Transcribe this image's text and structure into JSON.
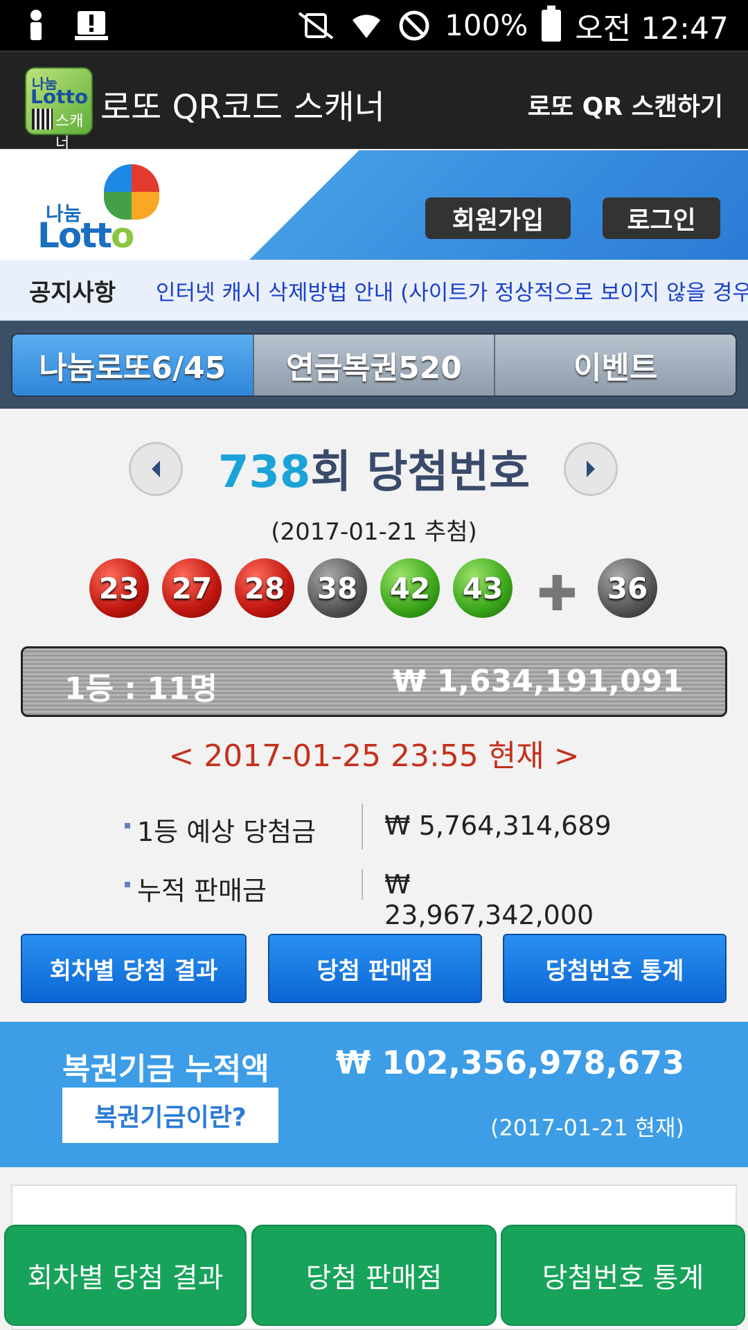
{
  "status_bar": {
    "battery": "100%",
    "time": "오전 12:47"
  },
  "action_bar": {
    "app_icon_text_1": "나눔",
    "app_icon_text_2": "Lotto",
    "app_icon_text_3": "스캐너",
    "title": "로또 QR코드 스캐너",
    "scan_button": "로또 QR 스캔하기"
  },
  "header": {
    "logo_small": "나눔",
    "logo_big_1": "Lott",
    "logo_big_2": "o",
    "join_button": "회원가입",
    "login_button": "로그인"
  },
  "notice": {
    "label": "공지사항",
    "text": "인터넷 캐시 삭제방법 안내 (사이트가 정상적으로 보이지 않을 경우"
  },
  "tabs": [
    {
      "label": "나눔로또6/45",
      "active": true
    },
    {
      "label": "연금복권520",
      "active": false
    },
    {
      "label": "이벤트",
      "active": false
    }
  ],
  "draw": {
    "round_number": "738",
    "round_suffix": "회 당첨번호",
    "date": "(2017-01-21 추첨)",
    "numbers": [
      {
        "value": "23",
        "color": "red"
      },
      {
        "value": "27",
        "color": "red"
      },
      {
        "value": "28",
        "color": "red"
      },
      {
        "value": "38",
        "color": "gray"
      },
      {
        "value": "42",
        "color": "green"
      },
      {
        "value": "43",
        "color": "green"
      }
    ],
    "bonus": {
      "value": "36",
      "color": "gray"
    },
    "first_prize_rank": "1등 : 11명",
    "first_prize_amount": "₩ 1,634,191,091",
    "as_of": "< 2017-01-25 23:55 현재 >",
    "expected_label": "1등 예상 당첨금",
    "expected_value": "₩ 5,764,314,689",
    "sales_label": "누적 판매금",
    "sales_value": "₩ 23,967,342,000",
    "buttons": [
      "회차별 당첨 결과",
      "당첨 판매점",
      "당첨번호 통계"
    ]
  },
  "fund": {
    "title": "복권기금 누적액",
    "amount": "₩ 102,356,978,673",
    "button": "복권기금이란?",
    "date": "(2017-01-21 현재)"
  },
  "bottom_bar": [
    "회차별 당첨 결과",
    "당첨 판매점",
    "당첨번호 통계"
  ],
  "colors": {
    "accent_blue": "#3d9de6",
    "bottom_green": "#17a35a",
    "as_of_red": "#c4301c"
  }
}
